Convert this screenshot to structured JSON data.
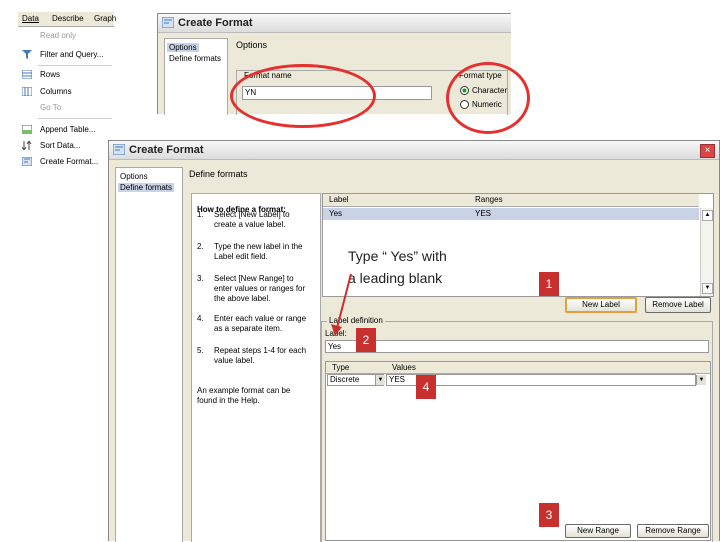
{
  "menu": {
    "bar": [
      "Data",
      "Describe",
      "Graph"
    ],
    "items": [
      {
        "label": "Read only",
        "icon": "none-icon",
        "disabled": true
      },
      {
        "label": "Filter and Query...",
        "icon": "filter-icon"
      },
      {
        "label": "Rows",
        "icon": "rows-icon"
      },
      {
        "label": "Columns",
        "icon": "columns-icon"
      },
      {
        "label": "Go To",
        "icon": "none-icon",
        "disabled": true
      },
      {
        "label": "Append Table...",
        "icon": "append-table-icon"
      },
      {
        "label": "Sort Data...",
        "icon": "sort-icon"
      },
      {
        "label": "Create Format...",
        "icon": "create-format-icon"
      }
    ]
  },
  "top_dialog": {
    "title": "Create Format",
    "nav": [
      "Options",
      "Define formats"
    ],
    "section": "Options",
    "format_name_label": "Format name",
    "format_name_value": "YN",
    "format_type_label": "Format type",
    "format_types": [
      "Character",
      "Numeric"
    ]
  },
  "main_dialog": {
    "title": "Create Format",
    "nav": [
      "Options",
      "Define formats"
    ],
    "section": "Define formats",
    "howto": {
      "title": "How to define a format:",
      "steps": [
        {
          "n": "1.",
          "text": "Select [New Label] to create a value label."
        },
        {
          "n": "2.",
          "text": "Type the new label in the Label edit field."
        },
        {
          "n": "3.",
          "text": "Select [New Range] to enter values or ranges for the above label."
        },
        {
          "n": "4.",
          "text": "Enter each value or range as a separate item."
        },
        {
          "n": "5.",
          "text": "Repeat steps 1-4 for each value label."
        }
      ],
      "footer": "An example format can be found in the Help."
    },
    "labels_table": {
      "headers": [
        "Label",
        "Ranges"
      ],
      "rows": [
        {
          "label": "Yes",
          "range": "YES"
        }
      ]
    },
    "new_label_btn": "New Label",
    "remove_label_btn": "Remove Label",
    "label_def_title": "Label definition",
    "label_field_label": "Label:",
    "label_value": "Yes",
    "range_headers": [
      "Type",
      "Values"
    ],
    "range_row": {
      "type": "Discrete",
      "value": "YES"
    },
    "new_range_btn": "New Range",
    "remove_range_btn": "Remove Range",
    "close": "×"
  },
  "annotations": {
    "note": "Type “ Yes” with a leading blank",
    "n1": "1",
    "n2": "2",
    "n3": "3",
    "n4": "4"
  },
  "colors": {
    "callout": "#c83030",
    "highlight": "#e53030",
    "selection": "#c9d3e6"
  }
}
